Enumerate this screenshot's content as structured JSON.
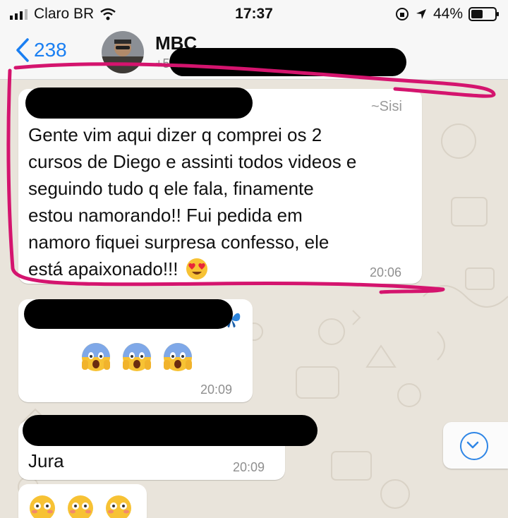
{
  "status_bar": {
    "carrier": "Claro BR",
    "time": "17:37",
    "battery": "44%"
  },
  "nav": {
    "back_count": "238",
    "contact_name": "MBC",
    "contact_subtitle": "+5"
  },
  "messages": [
    {
      "sender_alias": "~Sisi",
      "lines": [
        "Gente vim aqui dizer q comprei os 2",
        "cursos de Diego e assinti todos videos e",
        "seguindo tudo q ele fala, finamente",
        "estou namorando!! Fui pedida em",
        "namoro fiquei surpresa confesso, ele",
        "está apaixonado!!!"
      ],
      "time": "20:06"
    },
    {
      "time": "20:09"
    },
    {
      "text": "Jura",
      "time": "20:09"
    }
  ],
  "colors": {
    "accent": "#1a7ff2",
    "highlight": "#d4146e",
    "wallpaper": "#e9e4db"
  }
}
